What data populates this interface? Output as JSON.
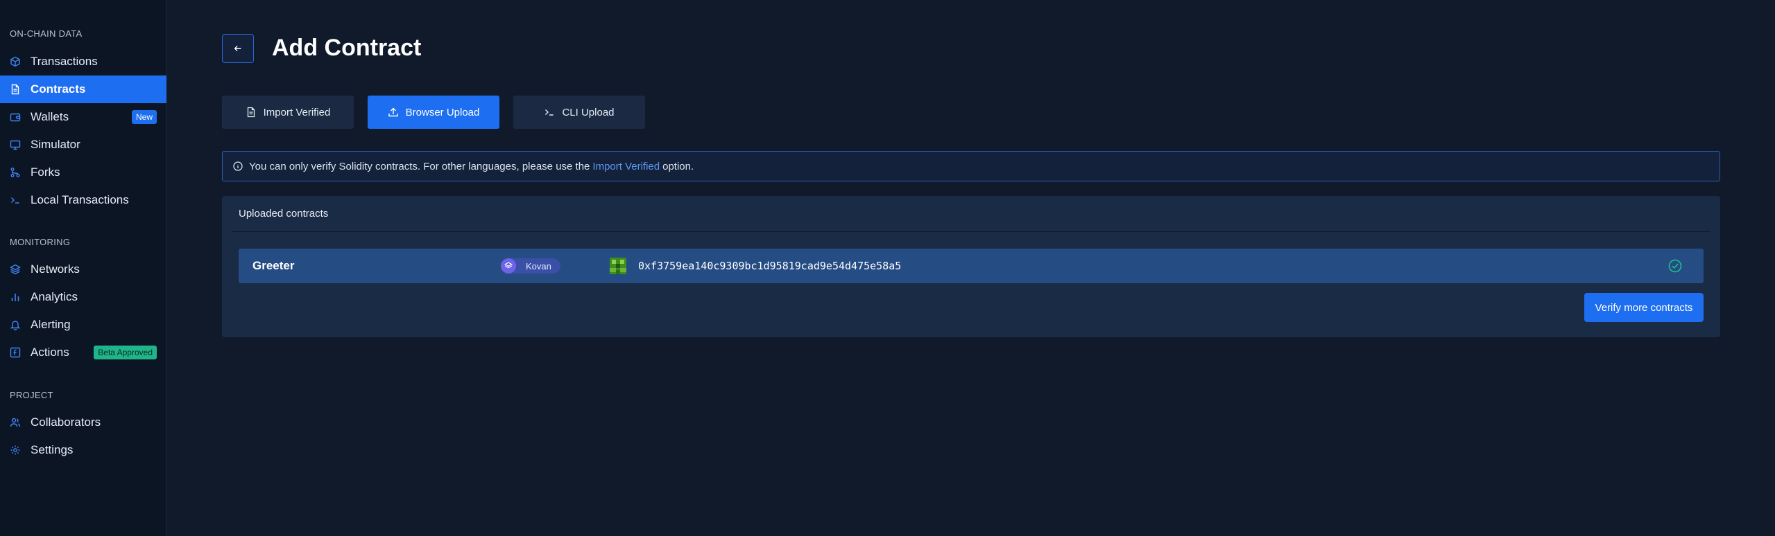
{
  "sidebar": {
    "sections": [
      {
        "title": "ON-CHAIN DATA"
      },
      {
        "title": "MONITORING"
      },
      {
        "title": "PROJECT"
      }
    ],
    "items": [
      {
        "label": "Transactions",
        "icon": "cube-icon"
      },
      {
        "label": "Contracts",
        "icon": "document-icon",
        "active": true
      },
      {
        "label": "Wallets",
        "icon": "wallet-icon",
        "badge": "New"
      },
      {
        "label": "Simulator",
        "icon": "monitor-icon"
      },
      {
        "label": "Forks",
        "icon": "fork-icon"
      },
      {
        "label": "Local Transactions",
        "icon": "terminal-icon"
      },
      {
        "label": "Networks",
        "icon": "layers-icon"
      },
      {
        "label": "Analytics",
        "icon": "bar-chart-icon"
      },
      {
        "label": "Alerting",
        "icon": "bell-icon"
      },
      {
        "label": "Actions",
        "icon": "function-icon",
        "badge": "Beta Approved"
      },
      {
        "label": "Collaborators",
        "icon": "users-icon"
      },
      {
        "label": "Settings",
        "icon": "gear-icon"
      }
    ]
  },
  "header": {
    "title": "Add Contract"
  },
  "tabs": [
    {
      "label": "Import Verified",
      "icon": "document-icon"
    },
    {
      "label": "Browser Upload",
      "icon": "upload-icon",
      "active": true
    },
    {
      "label": "CLI Upload",
      "icon": "terminal-icon"
    }
  ],
  "info": {
    "text_before": "You can only verify Solidity contracts. For other languages, please use the",
    "link": "Import Verified",
    "text_after": "option."
  },
  "uploaded": {
    "title": "Uploaded contracts",
    "contracts": [
      {
        "name": "Greeter",
        "network": "Kovan",
        "address": "0xf3759ea140c9309bc1d95819cad9e54d475e58a5"
      }
    ],
    "verify_more_label": "Verify more contracts"
  },
  "colors": {
    "accent": "#1e6ef2",
    "background": "#111a2b",
    "sidebar": "#0c1524",
    "success": "#1fb58a"
  }
}
